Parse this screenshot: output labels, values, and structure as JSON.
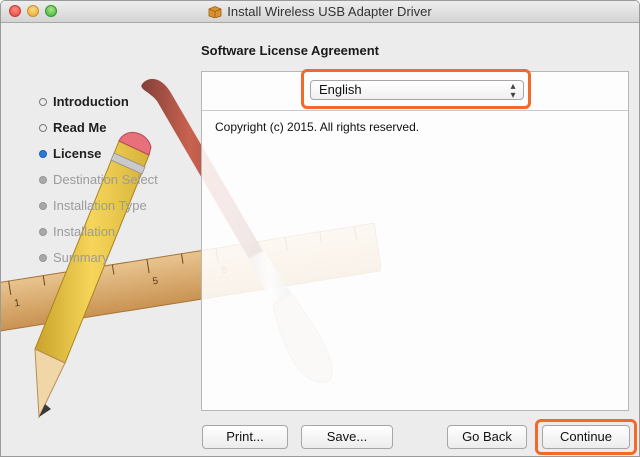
{
  "window": {
    "title": "Install Wireless USB Adapter Driver",
    "icons": [
      "close-icon",
      "minimize-icon",
      "zoom-icon",
      "package-icon"
    ]
  },
  "heading": "Software License Agreement",
  "sidebar": {
    "steps": [
      {
        "label": "Introduction",
        "state": "done"
      },
      {
        "label": "Read Me",
        "state": "done"
      },
      {
        "label": "License",
        "state": "current"
      },
      {
        "label": "Destination Select",
        "state": "pending"
      },
      {
        "label": "Installation Type",
        "state": "pending"
      },
      {
        "label": "Installation",
        "state": "pending"
      },
      {
        "label": "Summary",
        "state": "pending"
      }
    ]
  },
  "language": {
    "selected": "English",
    "icon": "up-down-chevron-icon"
  },
  "license": {
    "text": "Copyright (c) 2015.  All rights reserved."
  },
  "buttons": {
    "print": "Print...",
    "save": "Save...",
    "go_back": "Go Back",
    "continue": "Continue"
  },
  "colors": {
    "highlight": "#f06b2a",
    "current_step": "#2a7ad8"
  }
}
